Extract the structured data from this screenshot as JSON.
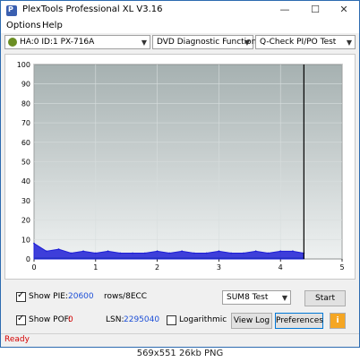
{
  "window": {
    "title": "PlexTools Professional XL V3.16",
    "minimize_glyph": "—",
    "maximize_glyph": "☐",
    "close_glyph": "✕"
  },
  "menu": {
    "options": "Options",
    "help": "Help"
  },
  "toolbar": {
    "drive": "HA:0 ID:1  PX-716A",
    "function": "DVD Diagnostic Functions",
    "test": "Q-Check PI/PO Test",
    "arrow": "▼"
  },
  "chart_data": {
    "type": "area",
    "title": "",
    "xlabel": "",
    "ylabel": "",
    "xlim": [
      0,
      5
    ],
    "ylim": [
      0,
      100
    ],
    "x_ticks": [
      "0",
      "1",
      "2",
      "3",
      "4",
      "5"
    ],
    "y_ticks": [
      "0",
      "10",
      "20",
      "30",
      "40",
      "50",
      "60",
      "70",
      "80",
      "90",
      "100"
    ],
    "end_marker_x": 4.38,
    "series": [
      {
        "x": [
          0.0,
          0.2,
          0.4,
          0.6,
          0.8,
          1.0,
          1.2,
          1.4,
          1.6,
          1.8,
          2.0,
          2.2,
          2.4,
          2.6,
          2.8,
          3.0,
          3.2,
          3.4,
          3.6,
          3.8,
          4.0,
          4.2,
          4.38
        ],
        "values": [
          8,
          4,
          5,
          3,
          4,
          3,
          4,
          3,
          3,
          3,
          4,
          3,
          4,
          3,
          3,
          4,
          3,
          3,
          4,
          3,
          4,
          4,
          3
        ]
      }
    ],
    "colors": {
      "plot_top": "#a6b1b1",
      "plot_bottom": "#eef1f1",
      "series": "#1f1fd6",
      "baseline": "#22aa22"
    }
  },
  "bottom": {
    "show_pie_label": "Show PIE:",
    "pie_value": "20600",
    "pie_unit": "rows/8ECC",
    "show_pof_label": "Show POF:",
    "pof_value": "0",
    "lsn_label": "LSN:",
    "lsn_value": "2295040",
    "logarithmic_label": "Logarithmic",
    "test_select": "SUM8 Test",
    "start_button": "Start",
    "view_log_button": "View Log",
    "preferences_button": "Preferences",
    "info_glyph": "i"
  },
  "status": "Ready",
  "caption": "569x551 26kb PNG"
}
